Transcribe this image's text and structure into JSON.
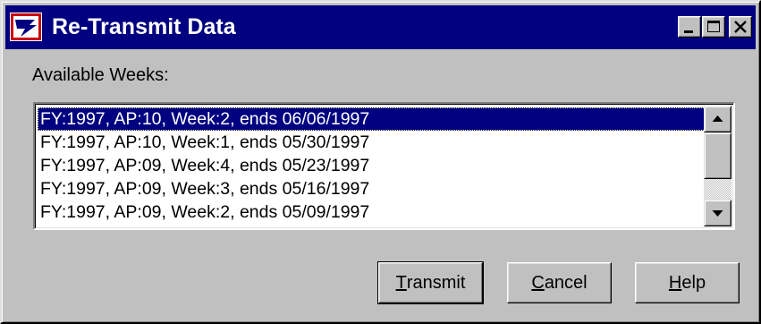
{
  "window": {
    "title": "Re-Transmit Data",
    "icon": "eagle-logo-icon"
  },
  "titlebar_buttons": [
    {
      "name": "minimize",
      "icon": "minimize-icon"
    },
    {
      "name": "maximize",
      "icon": "maximize-icon"
    },
    {
      "name": "close",
      "icon": "close-icon"
    }
  ],
  "available_weeks": {
    "label": "Available Weeks:",
    "selected_index": 0,
    "items": [
      "FY:1997, AP:10, Week:2, ends 06/06/1997",
      "FY:1997, AP:10, Week:1, ends 05/30/1997",
      "FY:1997, AP:09, Week:4, ends 05/23/1997",
      "FY:1997, AP:09, Week:3, ends 05/16/1997",
      "FY:1997, AP:09, Week:2, ends 05/09/1997"
    ]
  },
  "buttons": {
    "transmit": {
      "accel": "T",
      "rest": "ransmit"
    },
    "cancel": {
      "accel": "C",
      "rest": "ancel"
    },
    "help": {
      "accel": "H",
      "rest": "elp"
    }
  },
  "colors": {
    "titlebar": "#000080",
    "face": "#c0c0c0",
    "selection": "#000080"
  }
}
